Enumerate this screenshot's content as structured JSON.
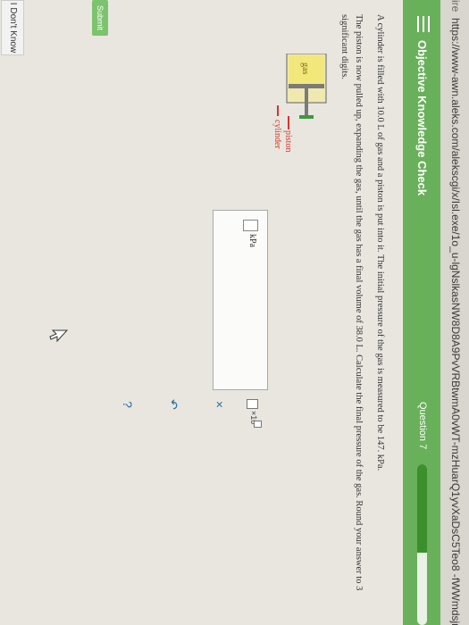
{
  "browser": {
    "tab_fragment": "ire",
    "url": "https://www-awn.aleks.com/alekscgi/x/Isl.exe/1o_u-lgNslkasNW8D8A9PvVRBtwmA0vWT-mzHuarQ1yvXaDsC5Teo8 -fWWmdsjn5 Ri"
  },
  "header": {
    "title": "Objective Knowledge Check",
    "question_label": "Question 7",
    "progress_percent": 55
  },
  "question": {
    "para1": "A cylinder is filled with 10.0 L of gas and a piston is put into it. The initial pressure of the gas is measured to be 147. kPa.",
    "para2": "The piston is now pulled up, expanding the gas, until the gas has a final volume of 38.0 L. Calculate the final pressure of the gas. Round your answer to 3 significant digits."
  },
  "diagram": {
    "gas_label": "gas",
    "piston_label": "piston",
    "cylinder_label": "cylinder"
  },
  "answer": {
    "value": "",
    "unit": "kPa",
    "sci_label": "×10"
  },
  "toolbar": {
    "clear": "×",
    "undo": "↶",
    "help": "?"
  },
  "buttons": {
    "submit": "Submit",
    "dont_know": "I Don't Know"
  },
  "colors": {
    "header_green": "#69b05a",
    "progress_fill": "#3c8f2d",
    "label_red": "#d9342b",
    "gas_yellow": "#f2e77a"
  }
}
